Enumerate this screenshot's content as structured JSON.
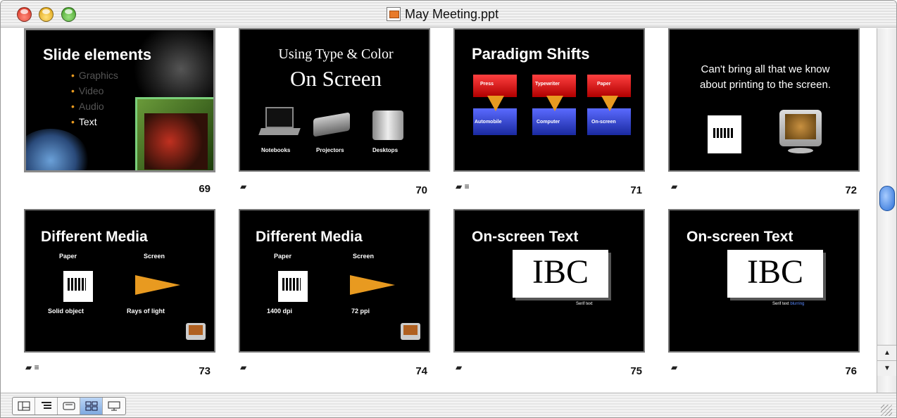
{
  "window": {
    "title": "May Meeting.ppt"
  },
  "slides": [
    {
      "number": "69",
      "title": "Slide elements",
      "bullets": [
        "Graphics",
        "Video",
        "Audio",
        "Text"
      ]
    },
    {
      "number": "70",
      "title_line1": "Using Type & Color",
      "title_line2": "On Screen",
      "labels": [
        "Notebooks",
        "Projectors",
        "Desktops"
      ]
    },
    {
      "number": "71",
      "title": "Paradigm Shifts",
      "top_labels": [
        "Press",
        "Typewriter",
        "Paper"
      ],
      "bottom_labels": [
        "Automobile",
        "Computer",
        "On-screen"
      ]
    },
    {
      "number": "72",
      "line1": "Can't bring all that we know",
      "line2": "about printing to the screen."
    },
    {
      "number": "73",
      "title": "Different Media",
      "col1": "Paper",
      "col2": "Screen",
      "cap1": "Solid object",
      "cap2": "Rays of light"
    },
    {
      "number": "74",
      "title": "Different Media",
      "col1": "Paper",
      "col2": "Screen",
      "cap1": "1400 dpi",
      "cap2": "72 ppi"
    },
    {
      "number": "75",
      "title": "On-screen Text",
      "logo": "IBC",
      "caption": "Serif text"
    },
    {
      "number": "76",
      "title": "On-screen Text",
      "logo": "IBC",
      "caption": "Serif text",
      "caption_link": "blurring"
    }
  ],
  "colors": {
    "accent": "#2a6fd6",
    "orange": "#e89a20",
    "red_box": "#e01010",
    "blue_box": "#2a3fd0"
  }
}
